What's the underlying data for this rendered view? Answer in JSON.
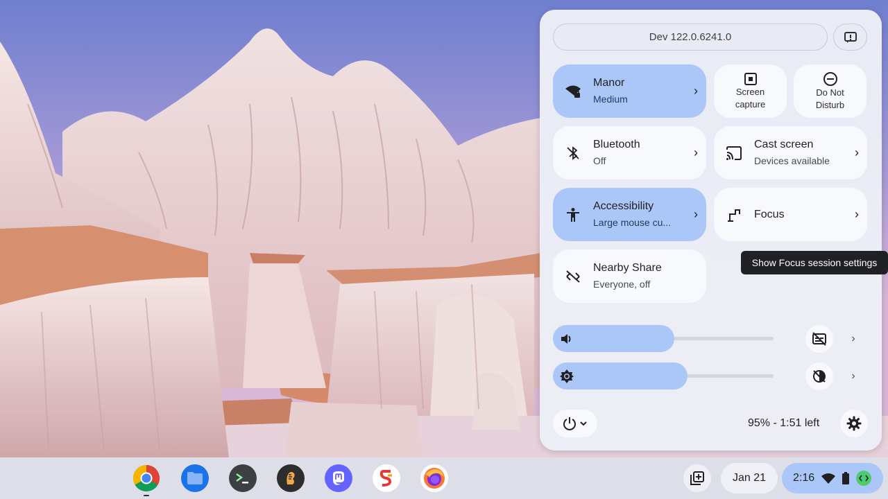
{
  "quick_settings": {
    "version": "Dev 122.0.6241.0",
    "feedback_icon": "feedback-icon",
    "tiles": {
      "network": {
        "name": "Manor",
        "sub": "Medium",
        "icon": "wifi-locked-icon",
        "state": "on"
      },
      "screen_capture": {
        "name": "Screen capture",
        "icon": "screen-capture-icon"
      },
      "dnd": {
        "name": "Do Not Disturb",
        "icon": "do-not-disturb-icon"
      },
      "bluetooth": {
        "name": "Bluetooth",
        "sub": "Off",
        "icon": "bluetooth-off-icon",
        "state": "off"
      },
      "cast": {
        "name": "Cast screen",
        "sub": "Devices available",
        "icon": "cast-icon"
      },
      "accessibility": {
        "name": "Accessibility",
        "sub": "Large mouse cu...",
        "icon": "accessibility-icon",
        "state": "on"
      },
      "focus": {
        "name": "Focus",
        "icon": "focus-icon"
      },
      "nearby_share": {
        "name": "Nearby Share",
        "sub": "Everyone, off",
        "icon": "nearby-share-off-icon"
      }
    },
    "volume": {
      "level": 0.55,
      "icon": "volume-icon",
      "side_icon": "live-caption-off-icon"
    },
    "brightness": {
      "level": 0.61,
      "icon": "brightness-icon",
      "side_icon": "night-light-off-icon"
    },
    "battery_text": "95% - 1:51 left",
    "power_icon": "power-icon",
    "settings_icon": "gear-icon"
  },
  "tooltip": {
    "text": "Show Focus session settings"
  },
  "shelf": {
    "apps": [
      {
        "name": "Chrome",
        "icon": "chrome-icon",
        "color": "#4285f4"
      },
      {
        "name": "Files",
        "icon": "files-icon",
        "color": "#1a73e8"
      },
      {
        "name": "Terminal",
        "icon": "terminal-icon",
        "color": "#3c4043"
      },
      {
        "name": "Elk",
        "icon": "elk-icon",
        "color": "#2d2d2d"
      },
      {
        "name": "Mastodon",
        "icon": "mastodon-icon",
        "color": "#6364ff"
      },
      {
        "name": "Slides",
        "icon": "slides-icon",
        "color": "#e53935"
      },
      {
        "name": "Firefox",
        "icon": "firefox-icon",
        "color": "#ff7139"
      }
    ],
    "date": "Jan 21",
    "time": "2:16",
    "colors": {
      "accent": "#aac7f8",
      "shelf": "#dcdee8"
    }
  }
}
